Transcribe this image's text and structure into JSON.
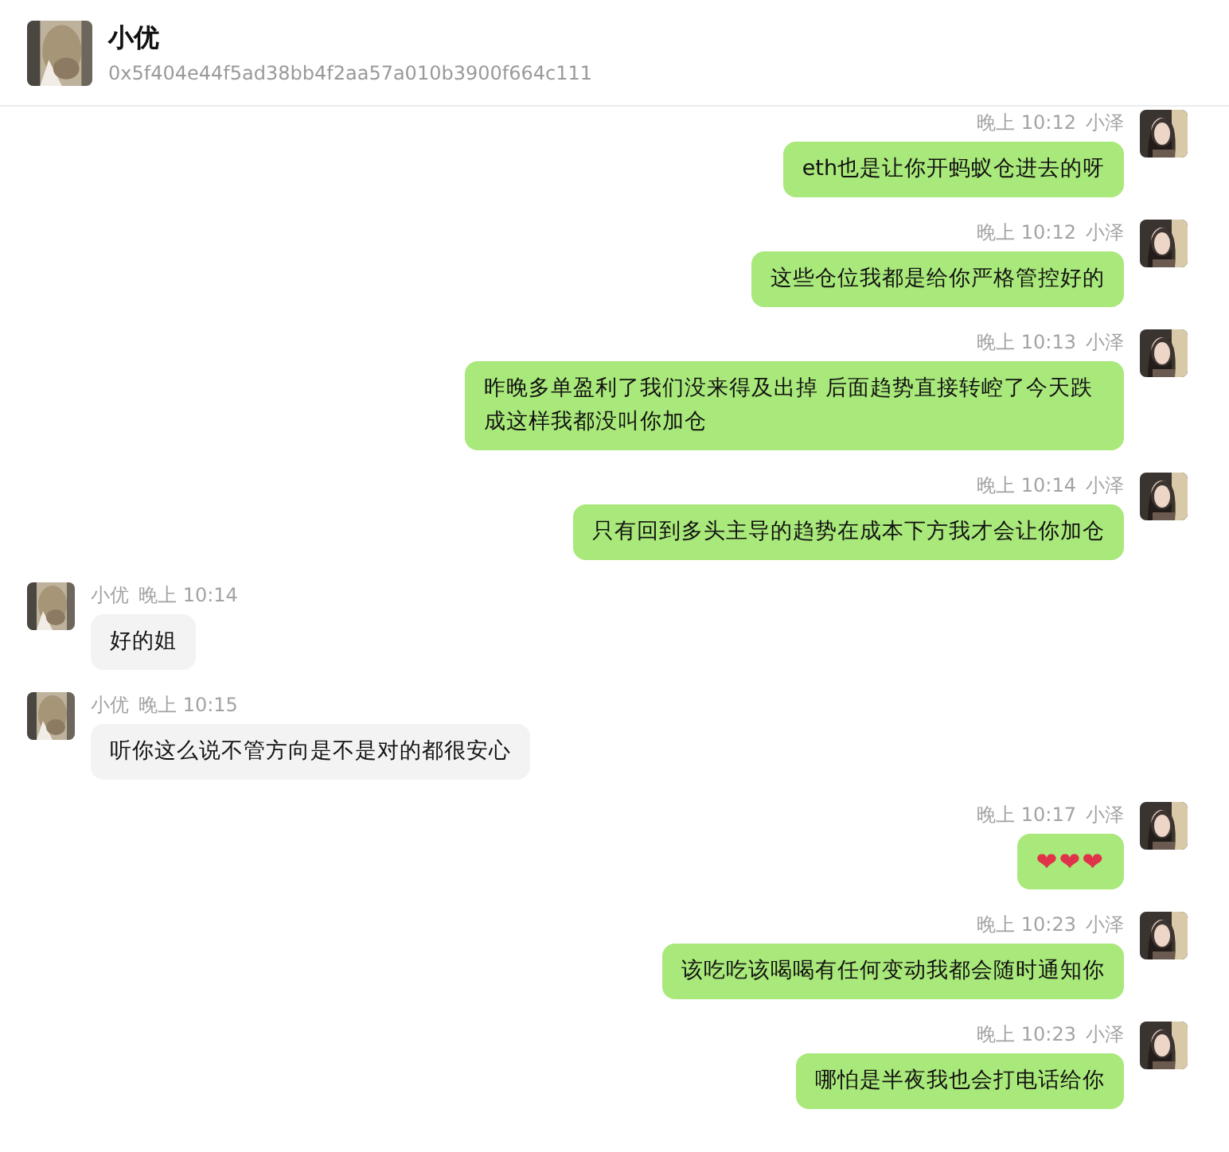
{
  "header": {
    "name": "小优",
    "address": "0x5f404e44f5ad38bb4f2aa57a010b3900f664c111"
  },
  "messages": [
    {
      "kind": "text",
      "outgoing": true,
      "time": "晚上 10:12",
      "sender": "小泽",
      "text": "eth也是让你开蚂蚁仓进去的呀"
    },
    {
      "kind": "text",
      "outgoing": true,
      "time": "晚上 10:12",
      "sender": "小泽",
      "text": "这些仓位我都是给你严格管控好的"
    },
    {
      "kind": "text",
      "outgoing": true,
      "time": "晚上 10:13",
      "sender": "小泽",
      "text": "昨晚多单盈利了我们没来得及出掉  后面趋势直接转崆了今天跌成这样我都没叫你加仓"
    },
    {
      "kind": "text",
      "outgoing": true,
      "time": "晚上 10:14",
      "sender": "小泽",
      "text": "只有回到多头主导的趋势在成本下方我才会让你加仓"
    },
    {
      "kind": "text",
      "outgoing": false,
      "time": "晚上 10:14",
      "sender": "小优",
      "text": "好的姐"
    },
    {
      "kind": "text",
      "outgoing": false,
      "time": "晚上 10:15",
      "sender": "小优",
      "text": "听你这么说不管方向是不是对的都很安心"
    },
    {
      "kind": "emoji",
      "outgoing": true,
      "time": "晚上 10:17",
      "sender": "小泽",
      "text": "❤❤❤"
    },
    {
      "kind": "text",
      "outgoing": true,
      "time": "晚上 10:23",
      "sender": "小泽",
      "text": "该吃吃该喝喝有任何变动我都会随时通知你"
    },
    {
      "kind": "text",
      "outgoing": true,
      "time": "晚上 10:23",
      "sender": "小泽",
      "text": "哪怕是半夜我也会打电话给你"
    }
  ]
}
